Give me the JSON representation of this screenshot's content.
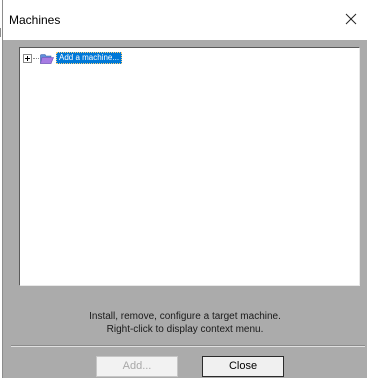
{
  "window": {
    "title": "Machines"
  },
  "tree": {
    "items": [
      {
        "label": "Add a machine...",
        "selected": true,
        "expandable": true
      }
    ]
  },
  "info": {
    "line1": "Install, remove, configure a target machine.",
    "line2": "Right-click to display context menu."
  },
  "buttons": {
    "add_label": "Add...",
    "add_enabled": false,
    "close_label": "Close"
  },
  "colors": {
    "dialog_bg": "#ababab",
    "selection": "#0078d7",
    "folder": "#7b61c9"
  }
}
